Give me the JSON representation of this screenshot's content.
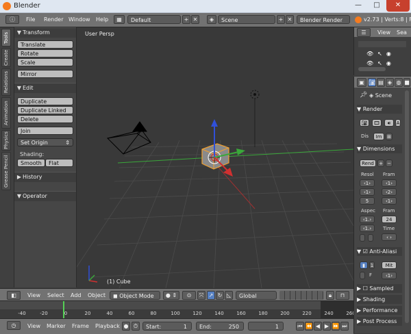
{
  "window": {
    "title": "Blender",
    "minimize": "—",
    "maximize": "□",
    "close": "✕"
  },
  "menubar": {
    "items": [
      "File",
      "Render",
      "Window",
      "Help"
    ],
    "layout": "Default",
    "scene": "Scene",
    "engine": "Blender Render",
    "version_stats": "v2.73 | Verts:8 | F"
  },
  "tool_tabs": [
    "Tools",
    "Create",
    "Relations",
    "Animation",
    "Physics",
    "Grease Pencil"
  ],
  "toolshelf": {
    "transform_header": "Transform",
    "translate": "Translate",
    "rotate": "Rotate",
    "scale": "Scale",
    "mirror": "Mirror",
    "edit_header": "Edit",
    "duplicate": "Duplicate",
    "duplicate_linked": "Duplicate Linked",
    "delete": "Delete",
    "join": "Join",
    "set_origin": "Set Origin",
    "shading_label": "Shading:",
    "smooth": "Smooth",
    "flat": "Flat",
    "history_header": "History",
    "operator_header": "Operator"
  },
  "viewport": {
    "label": "User Persp",
    "object": "(1) Cube"
  },
  "view_header": {
    "menus": [
      "View",
      "Select",
      "Add",
      "Object"
    ],
    "mode": "Object Mode",
    "orientation": "Global"
  },
  "timeline": {
    "ticks": [
      "-40",
      "-20",
      "0",
      "20",
      "40",
      "60",
      "80",
      "100",
      "120",
      "140",
      "160",
      "180",
      "200",
      "220",
      "240",
      "260"
    ],
    "menus": [
      "View",
      "Marker",
      "Frame",
      "Playback"
    ],
    "start_label": "Start:",
    "start": "1",
    "end_label": "End:",
    "end": "250",
    "current": "1"
  },
  "outliner": {
    "view": "View",
    "search": "Sea"
  },
  "properties": {
    "scene": "Scene",
    "render_header": "Render",
    "display_label": "Dis",
    "display_value": "Im",
    "dimensions_header": "Dimensions",
    "preset": "Rend",
    "resolution": "Resol",
    "frame": "Fram",
    "aspect": "Aspec",
    "frame2": "Fram",
    "frame_rate": "24",
    "time": "Time",
    "antialias_header": "Anti-Aliasi",
    "aa_value": "Mit",
    "f_label": "F",
    "sampled_header": "Sampled",
    "shading_header": "Shading",
    "performance_header": "Performance",
    "postprocess_header": "Post Process"
  },
  "colors": {
    "accent": "#f57b1f",
    "selected": "#5680c2",
    "x_axis": "#d03030",
    "y_axis": "#3aa83a",
    "z_axis": "#3050d8",
    "frame_cursor": "#55d055"
  }
}
